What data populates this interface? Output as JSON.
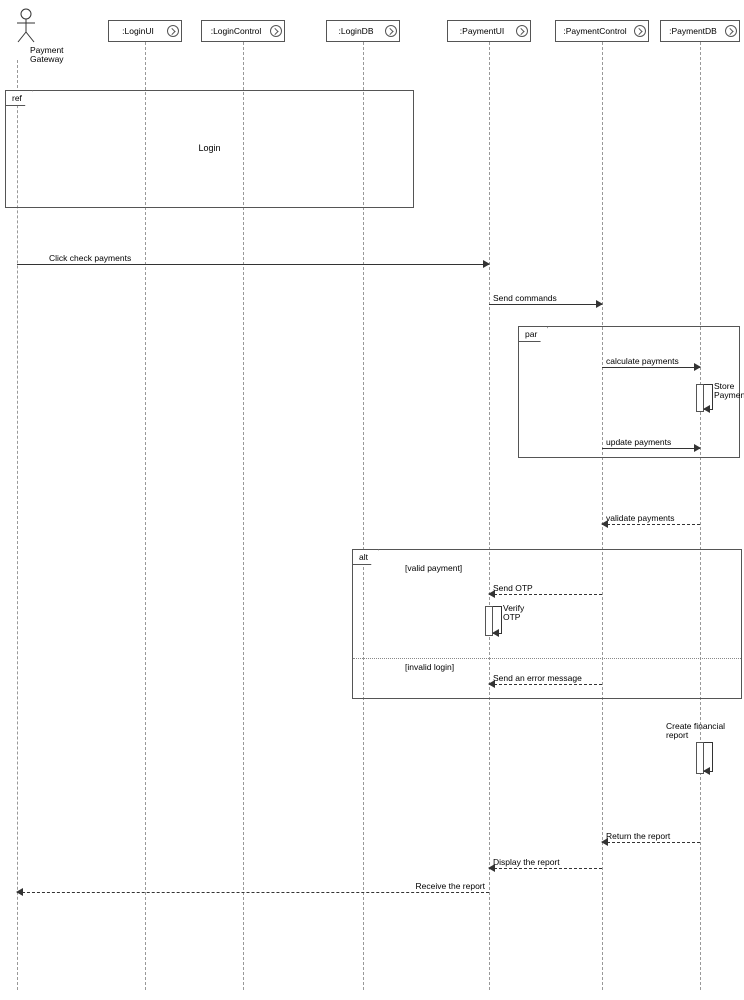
{
  "actor": {
    "name": "Payment\nGateway"
  },
  "objects": {
    "loginUI": {
      "label": ":LoginUI"
    },
    "loginControl": {
      "label": ":LoginControl"
    },
    "loginDB": {
      "label": ":LoginDB"
    },
    "paymentUI": {
      "label": ":PaymentUI"
    },
    "paymentControl": {
      "label": ":PaymentControl"
    },
    "paymentDB": {
      "label": ":PaymentDB"
    }
  },
  "fragments": {
    "ref": {
      "tag": "ref",
      "title": "Login"
    },
    "par": {
      "tag": "par"
    },
    "alt": {
      "tag": "alt",
      "guard_top": "[valid payment]",
      "guard_bottom": "[invalid login]"
    }
  },
  "messages": {
    "clickCheck": "Click check payments",
    "sendCommands": "Send commands",
    "calcPayments": "calculate payments",
    "storePayments": "Store\nPayments",
    "updatePayments": "update payments",
    "validatePayments": "validate payments",
    "sendOTP": "Send OTP",
    "verifyOTP": "Verify\nOTP",
    "sendError": "Send an error message",
    "createReport": "Create financial\nreport",
    "returnReport": "Return the report",
    "displayReport": "Display the report",
    "receiveReport": "Receive the report"
  }
}
